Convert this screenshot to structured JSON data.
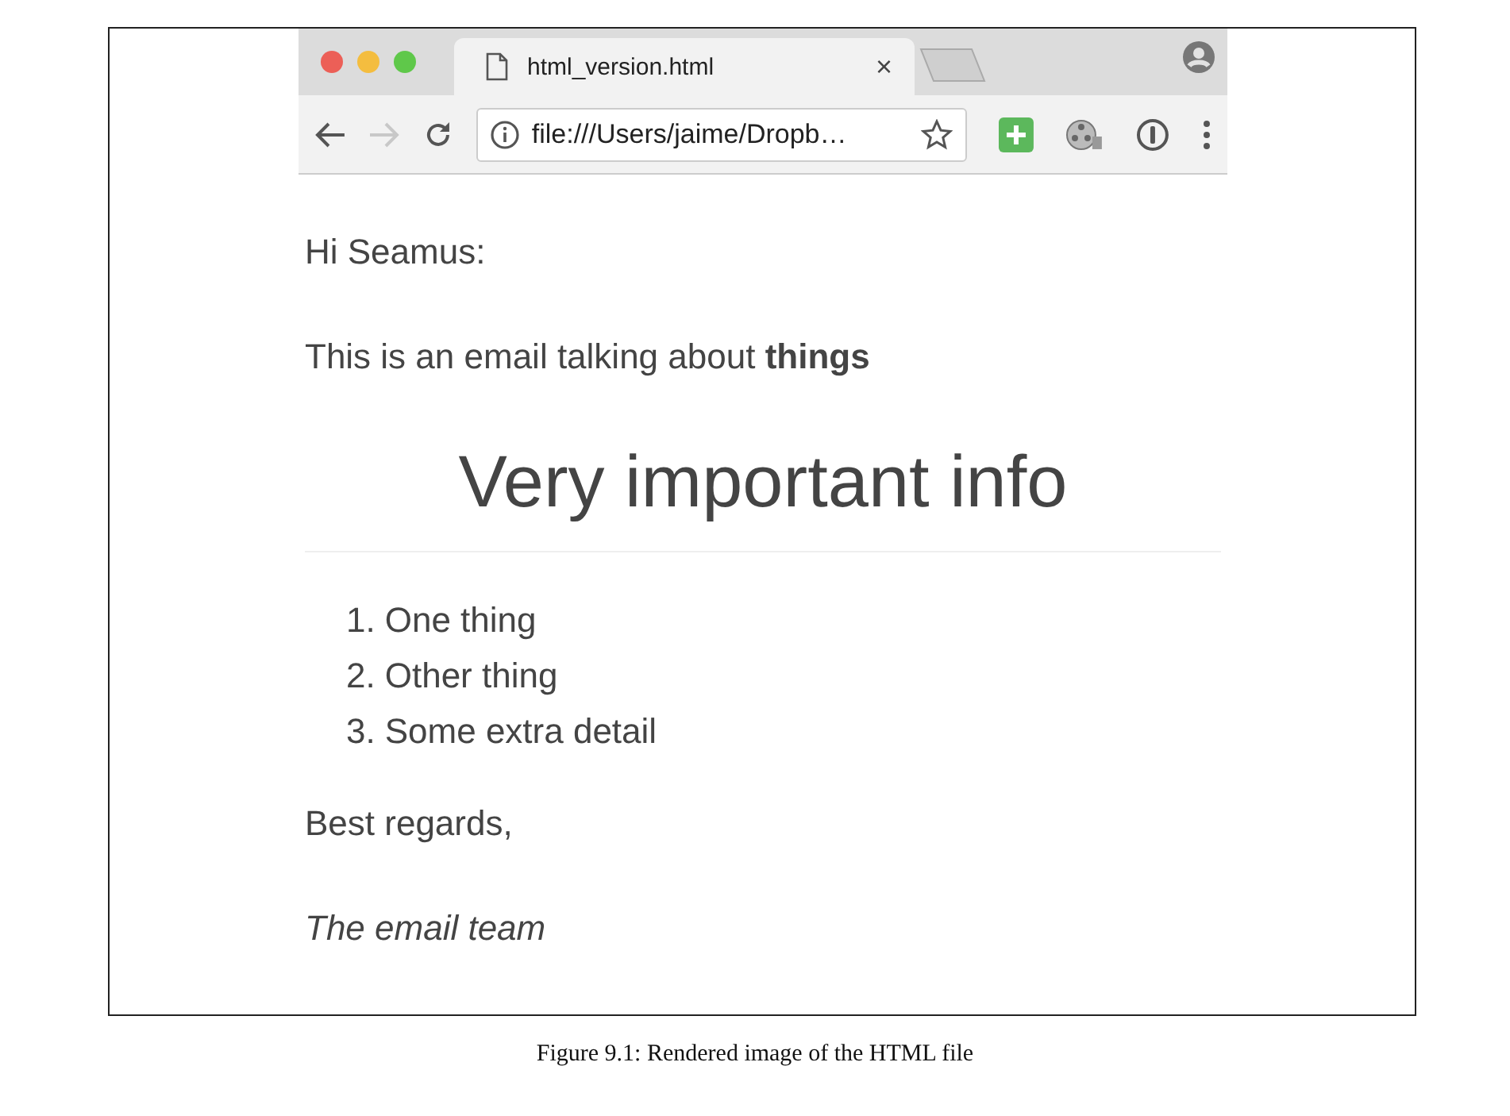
{
  "browser": {
    "tab": {
      "title": "html_version.html",
      "close": "×"
    },
    "nav_buttons": [
      {
        "kind": "back",
        "disabled": false
      },
      {
        "kind": "forward",
        "disabled": true
      },
      {
        "kind": "reload",
        "disabled": false
      }
    ],
    "address": "file:///Users/jaime/Dropb…"
  },
  "email": {
    "greeting": "Hi Seamus:",
    "intro": "This is an email talking about **things**",
    "heading": "Very important info",
    "list": [
      {
        "number": "1.",
        "text": "One thing"
      },
      {
        "number": "2.",
        "text": "Other thing"
      },
      {
        "number": "3.",
        "text": "Some extra detail"
      }
    ],
    "closing": "Best regards,",
    "signature": "The email team"
  },
  "caption": "Figure 9.1: Rendered image of the HTML file"
}
